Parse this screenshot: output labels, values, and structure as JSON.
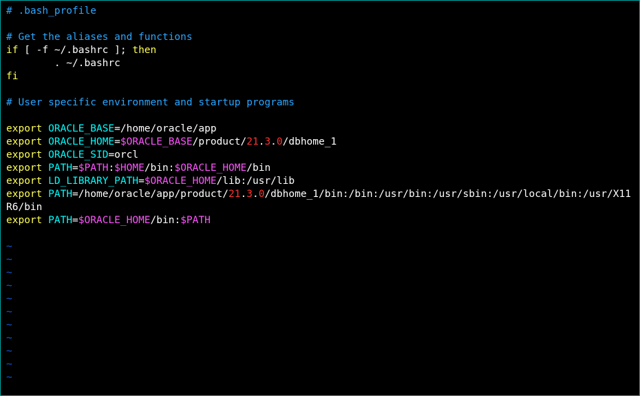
{
  "file": {
    "header_comment": "# .bash_profile",
    "aliases_comment": "# Get the aliases and functions",
    "if_open": "if",
    "if_test": " [ -f ~/.bashrc ]; ",
    "then_kw": "then",
    "source_line": "        . ~/.bashrc",
    "fi_kw": "fi",
    "env_comment": "# User specific environment and startup programs",
    "export_kw": "export",
    "vars": {
      "oracle_base": {
        "name": "ORACLE_BASE",
        "value": "/home/oracle/app"
      },
      "oracle_home": {
        "name": "ORACLE_HOME",
        "ref1": "$ORACLE_BASE",
        "seg1": "/product/",
        "num1": "21",
        "dot1": ".",
        "num2": "3",
        "dot2": ".",
        "num3": "0",
        "seg2": "/dbhome_1"
      },
      "oracle_sid": {
        "name": "ORACLE_SID",
        "value": "orcl"
      },
      "path1": {
        "name": "PATH",
        "ref1": "$PATH",
        "sep1": ":",
        "ref2": "$HOME",
        "seg1": "/bin:",
        "ref3": "$ORACLE_HOME",
        "seg2": "/bin"
      },
      "ld": {
        "name": "LD_LIBRARY_PATH",
        "ref1": "$ORACLE_HOME",
        "seg1": "/lib:/usr/lib"
      },
      "path2": {
        "name": "PATH",
        "seg1": "/home/oracle/app/product/",
        "num1": "21",
        "dot1": ".",
        "num2": "3",
        "dot2": ".",
        "num3": "0",
        "seg2": "/dbhome_1/bin:/bin:/usr/bin:/usr/sbin:/usr/local/bin:/usr/X11R6/bin"
      },
      "path3": {
        "name": "PATH",
        "ref1": "$ORACLE_HOME",
        "seg1": "/bin:",
        "ref2": "$PATH"
      }
    }
  },
  "tilde": "~"
}
